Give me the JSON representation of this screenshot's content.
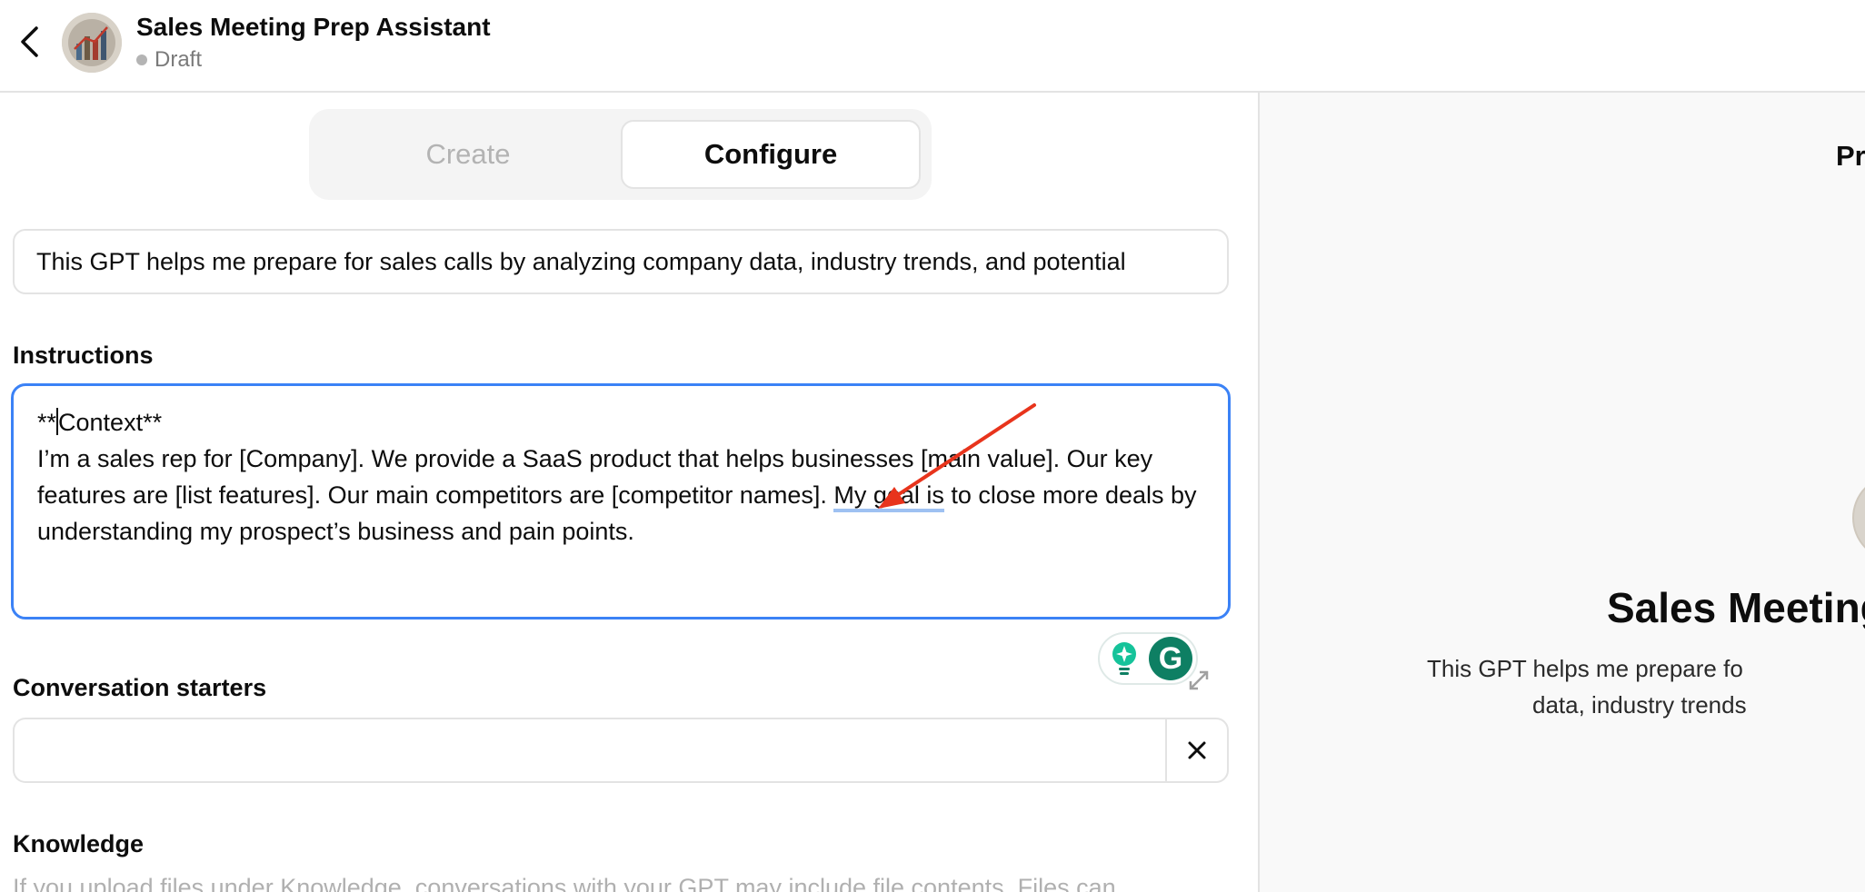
{
  "header": {
    "title": "Sales Meeting Prep Assistant",
    "status": "Draft"
  },
  "tabs": [
    {
      "label": "Create",
      "active": false
    },
    {
      "label": "Configure",
      "active": true
    }
  ],
  "description": {
    "value": "This GPT helps me prepare for sales calls by analyzing company data, industry trends, and potential"
  },
  "instructions": {
    "label": "Instructions",
    "line1_prefix": "**",
    "line1_rest": "Context**",
    "body_before": "I’m a sales rep for [Company]. We provide a SaaS product that helps businesses [main value]. Our key features are [list features]. Our main competitors are [competitor names]. ",
    "body_flagged": "My goal is",
    "body_after": " to close more deals by understanding my prospect’s business and pain points."
  },
  "conversation_starters": {
    "label": "Conversation starters",
    "value": ""
  },
  "knowledge": {
    "label": "Knowledge",
    "help": "If you upload files under Knowledge, conversations with your GPT may include file contents. Files can"
  },
  "preview": {
    "tab_label": "Pr",
    "title": "Sales Meeting",
    "desc_line1": "This GPT helps me prepare fo",
    "desc_line2": "data, industry trends"
  },
  "grammarly": {
    "letter": "G"
  },
  "colors": {
    "focus_border": "#3b82f6",
    "annotation_arrow": "#e8341c",
    "grammarly_green": "#0e7f63"
  },
  "icons": [
    "back-chevron-icon",
    "gpt-avatar-icon",
    "grammarly-bulb-icon",
    "grammarly-logo-icon",
    "expand-icon",
    "close-icon",
    "annotation-arrow"
  ]
}
